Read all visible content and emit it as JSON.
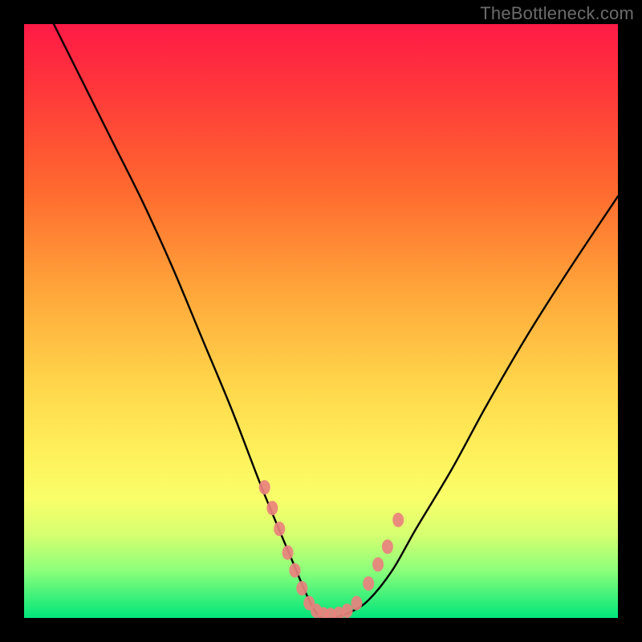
{
  "watermark": "TheBottleneck.com",
  "chart_data": {
    "type": "line",
    "title": "",
    "xlabel": "",
    "ylabel": "",
    "xlim": [
      0,
      100
    ],
    "ylim": [
      0,
      100
    ],
    "series": [
      {
        "name": "bottleneck-curve",
        "x": [
          0,
          5,
          10,
          15,
          20,
          25,
          30,
          35,
          40,
          45,
          48,
          50,
          52,
          55,
          58,
          62,
          66,
          72,
          78,
          85,
          92,
          100
        ],
        "y": [
          110,
          100,
          90,
          80,
          70,
          59,
          47,
          35,
          22,
          10,
          3,
          0,
          0,
          1,
          3,
          8,
          15,
          25,
          36,
          48,
          59,
          71
        ]
      }
    ],
    "markers": {
      "name": "highlight-dots",
      "color": "#e9817e",
      "x": [
        40.5,
        41.8,
        43.0,
        44.4,
        45.6,
        46.8,
        48.0,
        49.2,
        50.4,
        51.6,
        53.0,
        54.4,
        56.0,
        58.0,
        59.6,
        61.2,
        63.0
      ],
      "y": [
        22.0,
        18.5,
        15.0,
        11.0,
        8.0,
        5.0,
        2.5,
        1.2,
        0.6,
        0.5,
        0.7,
        1.2,
        2.5,
        5.8,
        9.0,
        12.0,
        16.5
      ]
    },
    "colors": {
      "curve": "#000000",
      "marker": "#e9817e",
      "background_top": "#ff1a46",
      "background_bottom": "#00e57a"
    }
  }
}
